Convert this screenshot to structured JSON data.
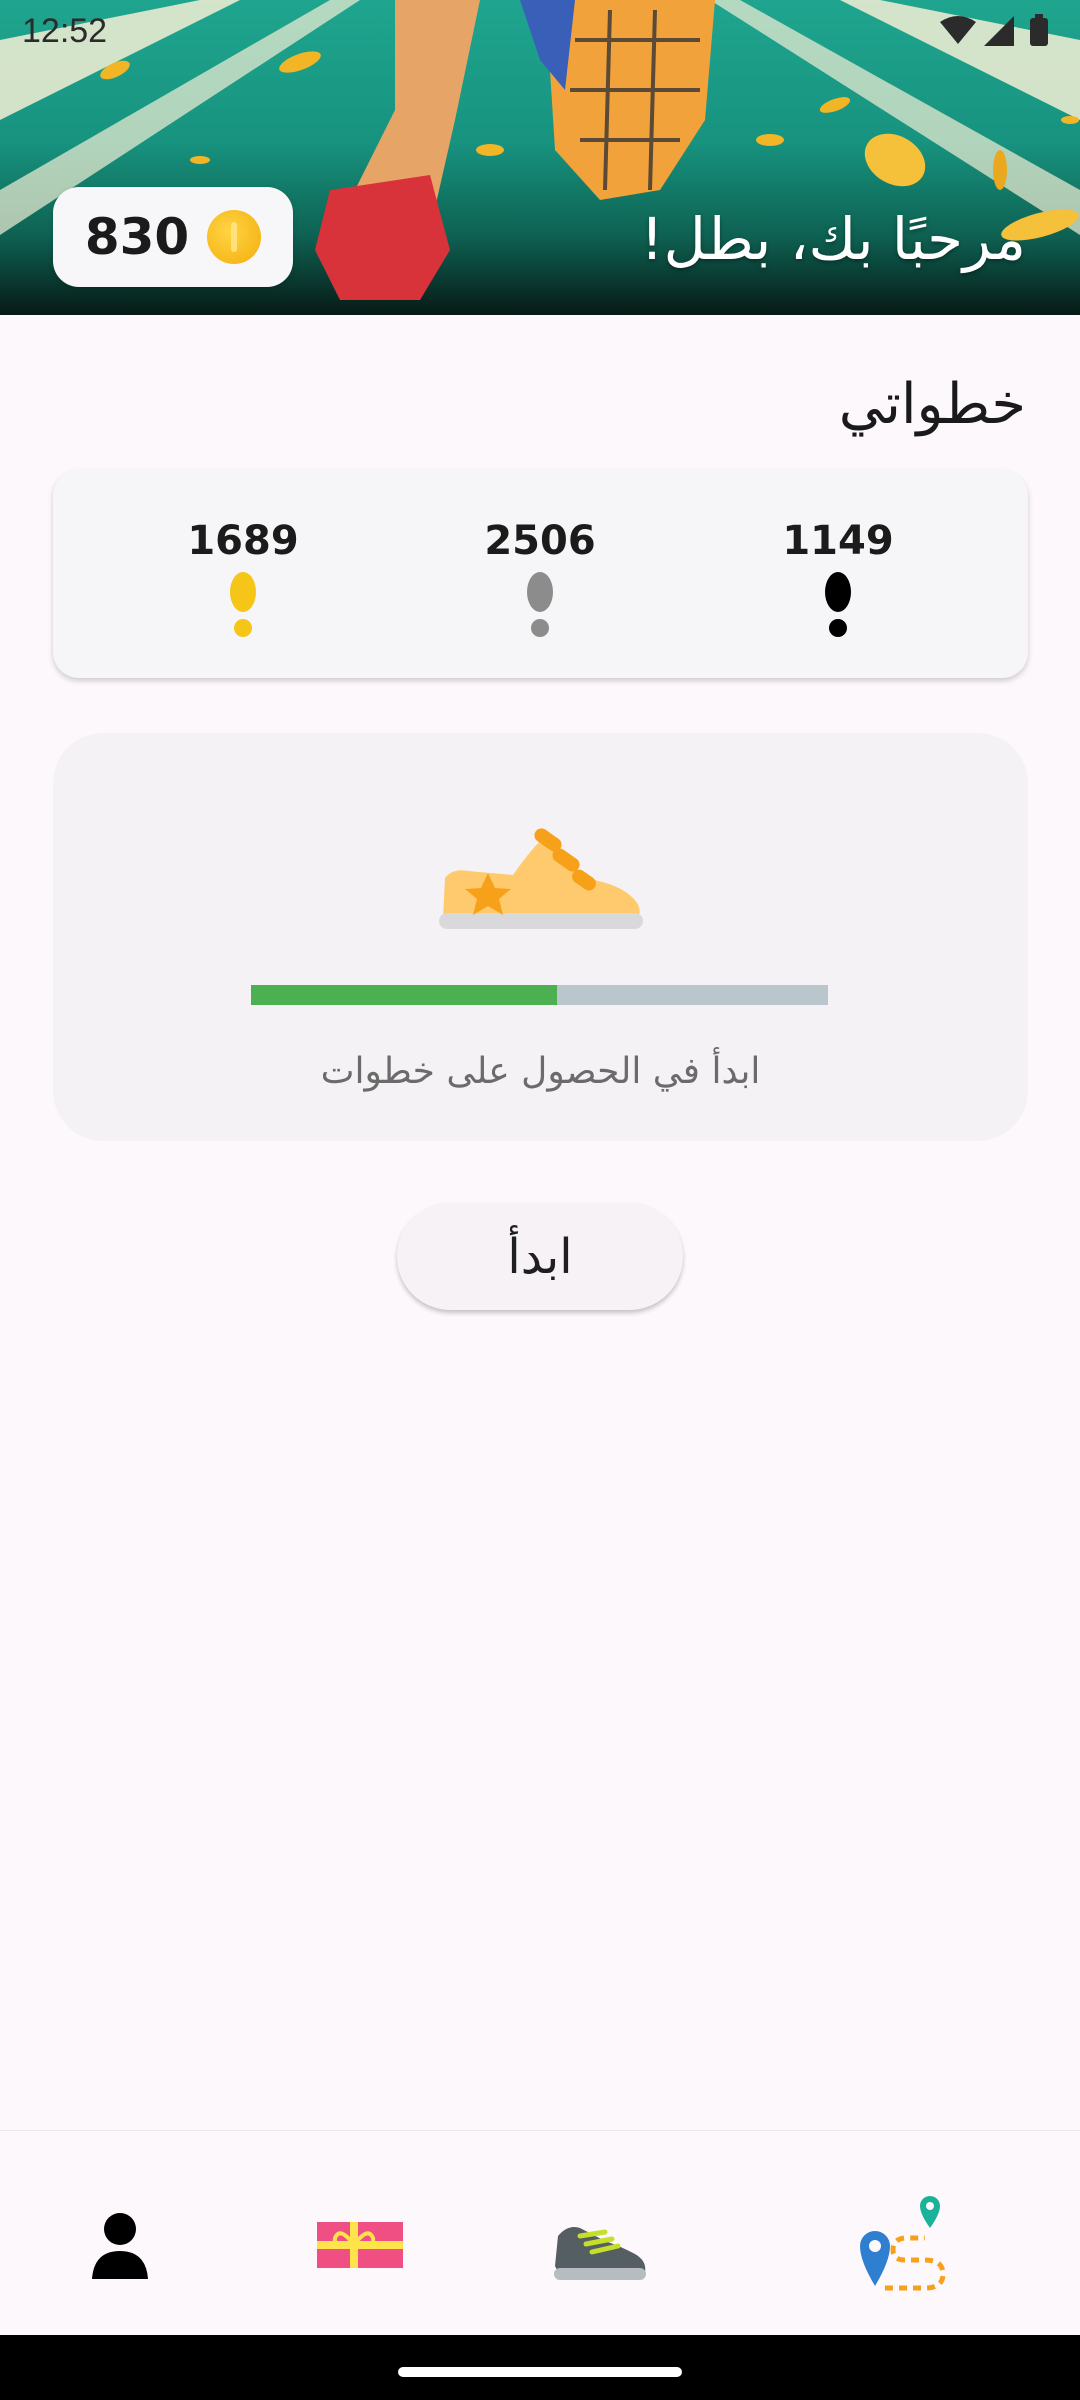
{
  "status_bar": {
    "time": "12:52"
  },
  "header": {
    "coins": "830",
    "greeting": "مرحبًا بك، بطل!"
  },
  "steps": {
    "section_title": "خطواتي",
    "counts": [
      {
        "value": "1149",
        "icon": "footprint-black-icon",
        "color": "#000000"
      },
      {
        "value": "2506",
        "icon": "footprint-gray-icon",
        "color": "#8c8c8c"
      },
      {
        "value": "1689",
        "icon": "footprint-yellow-icon",
        "color": "#f5c518"
      }
    ]
  },
  "progress": {
    "icon": "sneaker-star-icon",
    "fraction": 0.53,
    "message": "ابدأ في الحصول على خطوات"
  },
  "actions": {
    "start_label": "ابدأ"
  },
  "bottom_nav": {
    "items": [
      {
        "id": "route",
        "icon": "route-map-icon"
      },
      {
        "id": "shoe",
        "icon": "sneaker-icon"
      },
      {
        "id": "gift",
        "icon": "gift-card-icon"
      },
      {
        "id": "profile",
        "icon": "profile-icon"
      }
    ]
  },
  "colors": {
    "accent_green": "#4caf50",
    "coin_gold": "#f7b91b",
    "background": "#fdf8fc"
  }
}
